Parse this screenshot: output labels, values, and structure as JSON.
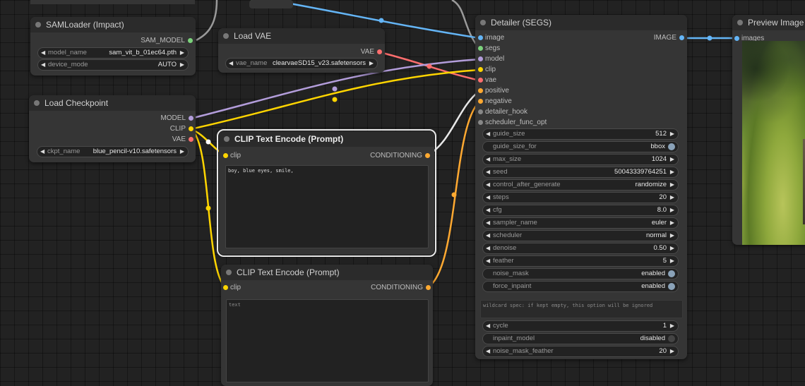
{
  "colors": {
    "image": "#64b5f6",
    "segs": "#7cd37c",
    "model": "#b39ddb",
    "clip": "#ffd500",
    "vae": "#ff6e6e",
    "conditioning": "#ffa931",
    "neutral": "#888888"
  },
  "nodes": {
    "samloader": {
      "title": "SAMLoader (Impact)",
      "out_sam_model": "SAM_MODEL",
      "widgets": [
        {
          "name": "model_name",
          "value": "sam_vit_b_01ec64.pth"
        },
        {
          "name": "device_mode",
          "value": "AUTO"
        }
      ]
    },
    "load_vae": {
      "title": "Load VAE",
      "out_vae": "VAE",
      "widgets": [
        {
          "name": "vae_name",
          "value": "clearvaeSD15_v23.safetensors"
        }
      ]
    },
    "load_checkpoint": {
      "title": "Load Checkpoint",
      "out_model": "MODEL",
      "out_clip": "CLIP",
      "out_vae": "VAE",
      "widgets": [
        {
          "name": "ckpt_name",
          "value": "blue_pencil-v10.safetensors"
        }
      ]
    },
    "clip_pos": {
      "title": "CLIP Text Encode (Prompt)",
      "in_clip": "clip",
      "out_conditioning": "CONDITIONING",
      "text": "boy, blue eyes, smile,"
    },
    "clip_neg": {
      "title": "CLIP Text Encode (Prompt)",
      "in_clip": "clip",
      "out_conditioning": "CONDITIONING",
      "placeholder": "text"
    },
    "detailer": {
      "title": "Detailer (SEGS)",
      "out_image": "IMAGE",
      "inputs": [
        "image",
        "segs",
        "model",
        "clip",
        "vae",
        "positive",
        "negative",
        "detailer_hook",
        "scheduler_func_opt"
      ],
      "widgets": [
        {
          "name": "guide_size",
          "value": "512",
          "kind": "number"
        },
        {
          "name": "guide_size_for",
          "value": "bbox",
          "kind": "toggle"
        },
        {
          "name": "max_size",
          "value": "1024",
          "kind": "number"
        },
        {
          "name": "seed",
          "value": "50043339764251",
          "kind": "number"
        },
        {
          "name": "control_after_generate",
          "value": "randomize",
          "kind": "combo"
        },
        {
          "name": "steps",
          "value": "20",
          "kind": "number"
        },
        {
          "name": "cfg",
          "value": "8.0",
          "kind": "number"
        },
        {
          "name": "sampler_name",
          "value": "euler",
          "kind": "combo"
        },
        {
          "name": "scheduler",
          "value": "normal",
          "kind": "combo"
        },
        {
          "name": "denoise",
          "value": "0.50",
          "kind": "number"
        },
        {
          "name": "feather",
          "value": "5",
          "kind": "number"
        },
        {
          "name": "noise_mask",
          "value": "enabled",
          "kind": "toggle"
        },
        {
          "name": "force_inpaint",
          "value": "enabled",
          "kind": "toggle"
        }
      ],
      "wildcard_placeholder": "wildcard spec: if kept empty, this option will be ignored",
      "widgets2": [
        {
          "name": "cycle",
          "value": "1",
          "kind": "number"
        },
        {
          "name": "inpaint_model",
          "value": "disabled",
          "kind": "toggle-off"
        },
        {
          "name": "noise_mask_feather",
          "value": "20",
          "kind": "number"
        }
      ]
    },
    "preview": {
      "title": "Preview Image",
      "in_images": "images"
    }
  }
}
